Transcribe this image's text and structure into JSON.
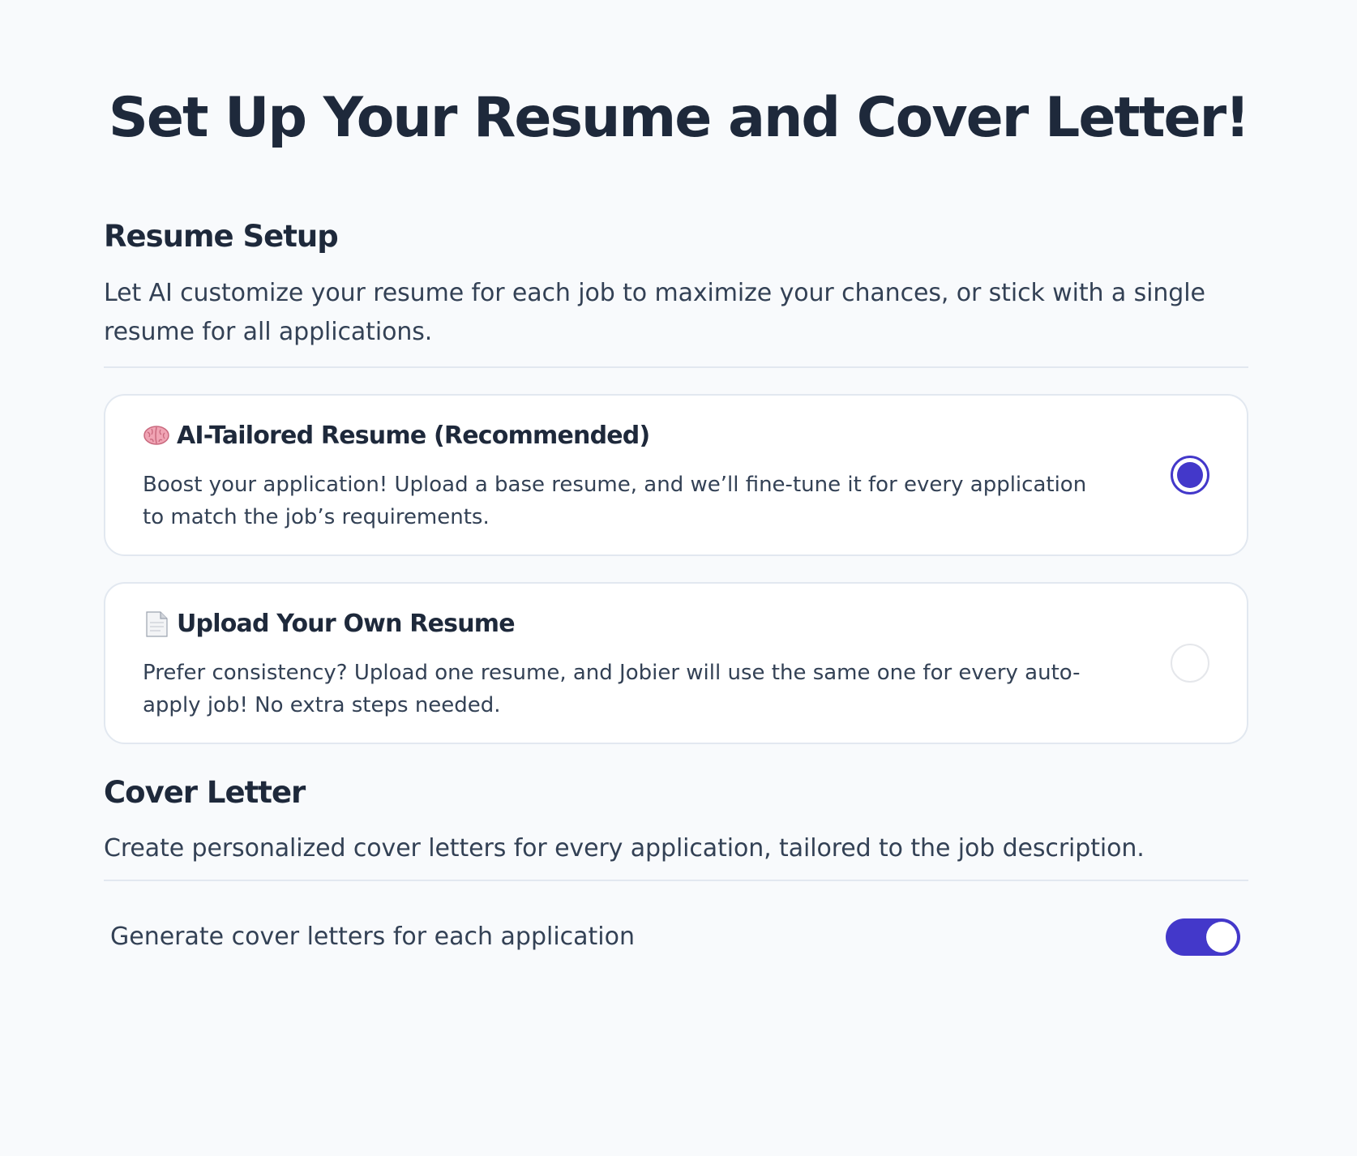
{
  "title": "Set Up Your Resume and Cover Letter!",
  "resume_setup": {
    "heading": "Resume Setup",
    "description": "Let AI customize your resume for each job to maximize your chances, or stick with a single resume for all applications.",
    "options": [
      {
        "icon": "brain-icon",
        "title": "AI-Tailored Resume (Recommended)",
        "description": "Boost your application! Upload a base resume, and we’ll fine-tune it for every application to match the job’s requirements.",
        "selected": true
      },
      {
        "icon": "document-icon",
        "title": "Upload Your Own Resume",
        "description": "Prefer consistency? Upload one resume, and Jobier will use the same one for every auto-apply job! No extra steps needed.",
        "selected": false
      }
    ]
  },
  "cover_letter": {
    "heading": "Cover Letter",
    "description": "Create personalized cover letters for every application, tailored to the job description.",
    "toggle_label": "Generate cover letters for each application",
    "toggle_on": true
  },
  "colors": {
    "accent": "#4338ca",
    "title": "#1e293b",
    "text": "#334155",
    "border": "#e2e8f0",
    "background": "#f8fafc"
  }
}
